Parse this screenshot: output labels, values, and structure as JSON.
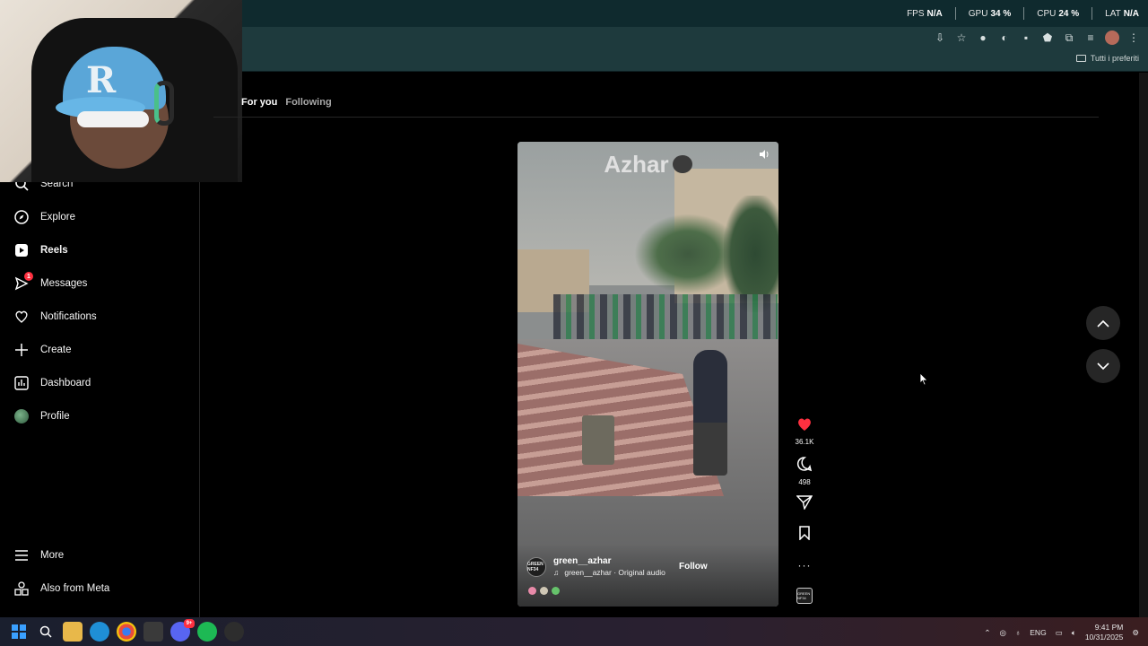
{
  "overlay_stats": [
    {
      "label": "FPS",
      "value": "N/A"
    },
    {
      "label": "GPU",
      "value": "34 %"
    },
    {
      "label": "CPU",
      "value": "24 %"
    },
    {
      "label": "LAT",
      "value": "N/A"
    }
  ],
  "browser": {
    "bookmarks_folder": "Tutti i preferiti",
    "toolbar_icons": [
      "install-icon",
      "star-icon",
      "extension-1-icon",
      "extension-2-icon",
      "extension-3-icon",
      "shield-icon",
      "puzzle-icon",
      "media-icon",
      "profile-avatar",
      "menu-dots-icon"
    ]
  },
  "sidebar": {
    "items": [
      {
        "label": "Search",
        "icon": "search-icon"
      },
      {
        "label": "Explore",
        "icon": "compass-icon"
      },
      {
        "label": "Reels",
        "icon": "reels-icon",
        "active": true
      },
      {
        "label": "Messages",
        "icon": "messenger-icon",
        "badge": "1"
      },
      {
        "label": "Notifications",
        "icon": "heart-icon"
      },
      {
        "label": "Create",
        "icon": "plus-icon"
      },
      {
        "label": "Dashboard",
        "icon": "chart-icon"
      },
      {
        "label": "Profile",
        "icon": "profile-avatar"
      }
    ],
    "bottom": [
      {
        "label": "More",
        "icon": "hamburger-icon"
      },
      {
        "label": "Also from Meta",
        "icon": "meta-apps-icon"
      }
    ]
  },
  "feed_tabs": {
    "active": "For you",
    "inactive": "Following"
  },
  "reel": {
    "title": "Azhar",
    "author": "green__azhar",
    "audio": "green__azhar · Original audio",
    "follow_label": "Follow",
    "avatar_text": "GREEN NF34",
    "likes": "36.1K",
    "comments": "498"
  },
  "taskbar": {
    "language": "ENG",
    "time": "9:41 PM",
    "date": "10/31/2025",
    "discord_badge": "9+"
  },
  "colors": {
    "like_red": "#ff3040",
    "bg": "#000000",
    "chrome": "#1e3a3d"
  }
}
